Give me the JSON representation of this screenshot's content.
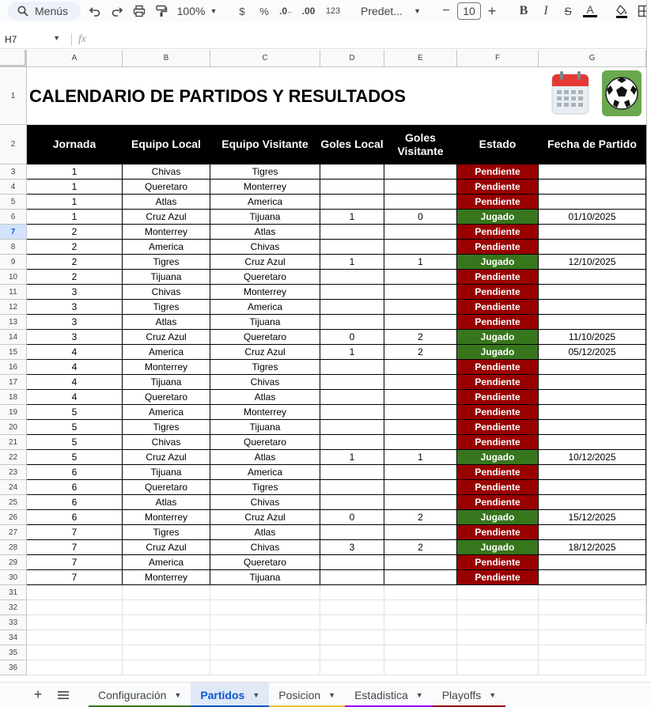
{
  "toolbar": {
    "search_label": "Menús",
    "zoom": "100%",
    "currency": "$",
    "percent": "%",
    "dec_decrease": ".0",
    "dec_increase": ".00",
    "number_format": "123",
    "font": "Predet...",
    "font_size": "10",
    "minus": "−",
    "plus": "+",
    "bold": "B",
    "italic": "I",
    "strike": "S",
    "text_color": "A"
  },
  "formula_bar": {
    "name_box": "H7",
    "fx": "fx"
  },
  "columns": [
    "A",
    "B",
    "C",
    "D",
    "E",
    "F",
    "G"
  ],
  "title": "CALENDARIO DE PARTIDOS Y RESULTADOS",
  "headers": [
    "Jornada",
    "Equipo Local",
    "Equipo Visitante",
    "Goles Local",
    "Goles Visitante",
    "Estado",
    "Fecha de Partido"
  ],
  "row_numbers": [
    "1",
    "2",
    "3",
    "4",
    "5",
    "6",
    "7",
    "8",
    "9",
    "10",
    "11",
    "12",
    "13",
    "14",
    "15",
    "16",
    "17",
    "18",
    "19",
    "20",
    "21",
    "22",
    "23",
    "24",
    "25",
    "26",
    "27",
    "28",
    "29",
    "30",
    "31",
    "32",
    "33",
    "34",
    "35",
    "36"
  ],
  "rows": [
    [
      "1",
      "Chivas",
      "Tigres",
      "",
      "",
      "Pendiente",
      ""
    ],
    [
      "1",
      "Queretaro",
      "Monterrey",
      "",
      "",
      "Pendiente",
      ""
    ],
    [
      "1",
      "Atlas",
      "America",
      "",
      "",
      "Pendiente",
      ""
    ],
    [
      "1",
      "Cruz Azul",
      "Tijuana",
      "1",
      "0",
      "Jugado",
      "01/10/2025"
    ],
    [
      "2",
      "Monterrey",
      "Atlas",
      "",
      "",
      "Pendiente",
      ""
    ],
    [
      "2",
      "America",
      "Chivas",
      "",
      "",
      "Pendiente",
      ""
    ],
    [
      "2",
      "Tigres",
      "Cruz Azul",
      "1",
      "1",
      "Jugado",
      "12/10/2025"
    ],
    [
      "2",
      "Tijuana",
      "Queretaro",
      "",
      "",
      "Pendiente",
      ""
    ],
    [
      "3",
      "Chivas",
      "Monterrey",
      "",
      "",
      "Pendiente",
      ""
    ],
    [
      "3",
      "Tigres",
      "America",
      "",
      "",
      "Pendiente",
      ""
    ],
    [
      "3",
      "Atlas",
      "Tijuana",
      "",
      "",
      "Pendiente",
      ""
    ],
    [
      "3",
      "Cruz Azul",
      "Queretaro",
      "0",
      "2",
      "Jugado",
      "11/10/2025"
    ],
    [
      "4",
      "America",
      "Cruz Azul",
      "1",
      "2",
      "Jugado",
      "05/12/2025"
    ],
    [
      "4",
      "Monterrey",
      "Tigres",
      "",
      "",
      "Pendiente",
      ""
    ],
    [
      "4",
      "Tijuana",
      "Chivas",
      "",
      "",
      "Pendiente",
      ""
    ],
    [
      "4",
      "Queretaro",
      "Atlas",
      "",
      "",
      "Pendiente",
      ""
    ],
    [
      "5",
      "America",
      "Monterrey",
      "",
      "",
      "Pendiente",
      ""
    ],
    [
      "5",
      "Tigres",
      "Tijuana",
      "",
      "",
      "Pendiente",
      ""
    ],
    [
      "5",
      "Chivas",
      "Queretaro",
      "",
      "",
      "Pendiente",
      ""
    ],
    [
      "5",
      "Cruz Azul",
      "Atlas",
      "1",
      "1",
      "Jugado",
      "10/12/2025"
    ],
    [
      "6",
      "Tijuana",
      "America",
      "",
      "",
      "Pendiente",
      ""
    ],
    [
      "6",
      "Queretaro",
      "Tigres",
      "",
      "",
      "Pendiente",
      ""
    ],
    [
      "6",
      "Atlas",
      "Chivas",
      "",
      "",
      "Pendiente",
      ""
    ],
    [
      "6",
      "Monterrey",
      "Cruz Azul",
      "0",
      "2",
      "Jugado",
      "15/12/2025"
    ],
    [
      "7",
      "Tigres",
      "Atlas",
      "",
      "",
      "Pendiente",
      ""
    ],
    [
      "7",
      "Cruz Azul",
      "Chivas",
      "3",
      "2",
      "Jugado",
      "18/12/2025"
    ],
    [
      "7",
      "America",
      "Queretaro",
      "",
      "",
      "Pendiente",
      ""
    ],
    [
      "7",
      "Monterrey",
      "Tijuana",
      "",
      "",
      "Pendiente",
      ""
    ]
  ],
  "selected_row": "7",
  "tabs": [
    {
      "label": "Configuración",
      "color": "#38761d",
      "active": false
    },
    {
      "label": "Partidos",
      "color": "#1155cc",
      "active": true
    },
    {
      "label": "Posicion",
      "color": "#f1c232",
      "active": false
    },
    {
      "label": "Estadistica",
      "color": "#9900ff",
      "active": false
    },
    {
      "label": "Playoffs",
      "color": "#990000",
      "active": false
    }
  ],
  "colors": {
    "pendiente": "#990000",
    "jugado": "#38761d",
    "header_bg": "#000000"
  }
}
